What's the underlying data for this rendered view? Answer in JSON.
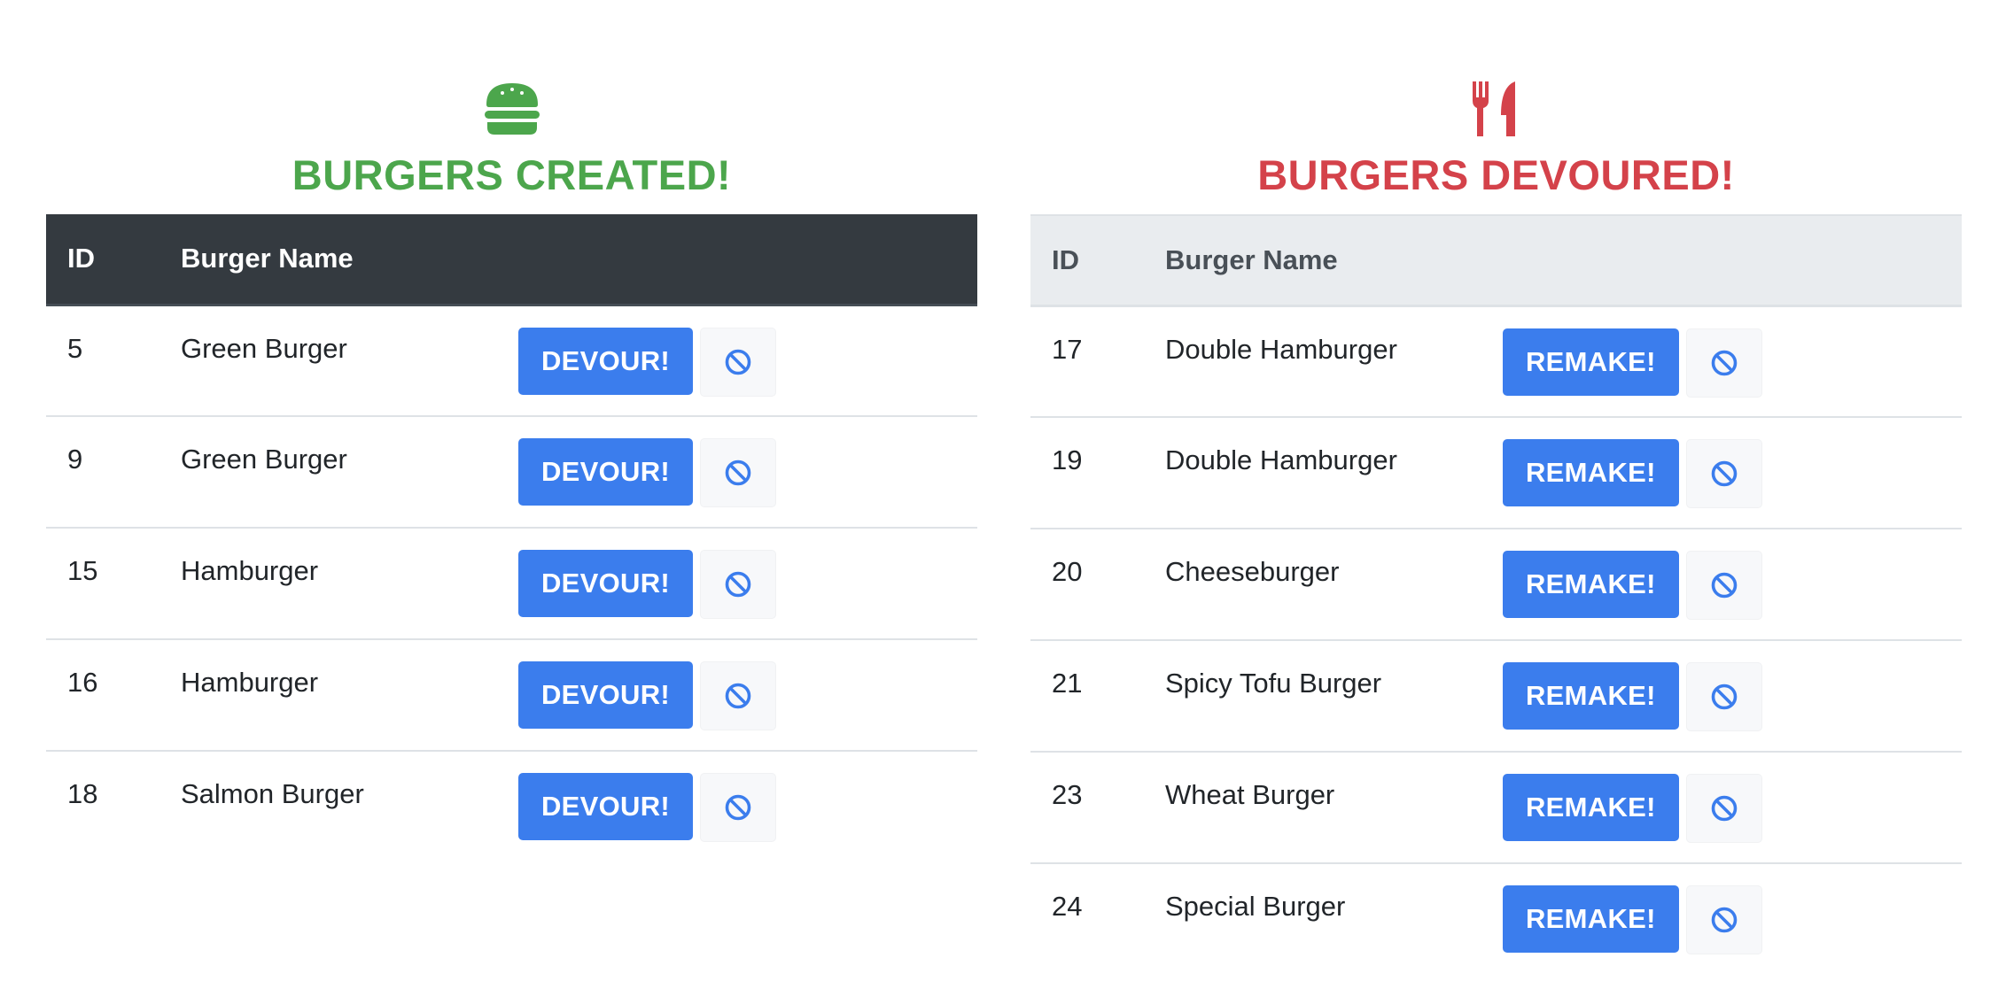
{
  "created": {
    "title": "BURGERS CREATED!",
    "icon": "hamburger-icon",
    "color": "#4ca64c",
    "columns": {
      "id": "ID",
      "name": "Burger Name"
    },
    "action_label": "DEVOUR!",
    "rows": [
      {
        "id": "5",
        "name": "Green Burger"
      },
      {
        "id": "9",
        "name": "Green Burger"
      },
      {
        "id": "15",
        "name": "Hamburger"
      },
      {
        "id": "16",
        "name": "Hamburger"
      },
      {
        "id": "18",
        "name": "Salmon Burger"
      }
    ]
  },
  "devoured": {
    "title": "BURGERS DEVOURED!",
    "icon": "utensils-icon",
    "color": "#d4424a",
    "columns": {
      "id": "ID",
      "name": "Burger Name"
    },
    "action_label": "REMAKE!",
    "rows": [
      {
        "id": "17",
        "name": "Double Hamburger"
      },
      {
        "id": "19",
        "name": "Double Hamburger"
      },
      {
        "id": "20",
        "name": "Cheeseburger"
      },
      {
        "id": "21",
        "name": "Spicy Tofu Burger"
      },
      {
        "id": "23",
        "name": "Wheat Burger"
      },
      {
        "id": "24",
        "name": "Special Burger"
      }
    ]
  },
  "theme": {
    "button_color": "#3b7ded",
    "remove_icon": "ban-icon",
    "remove_icon_color": "#3b7ded"
  }
}
